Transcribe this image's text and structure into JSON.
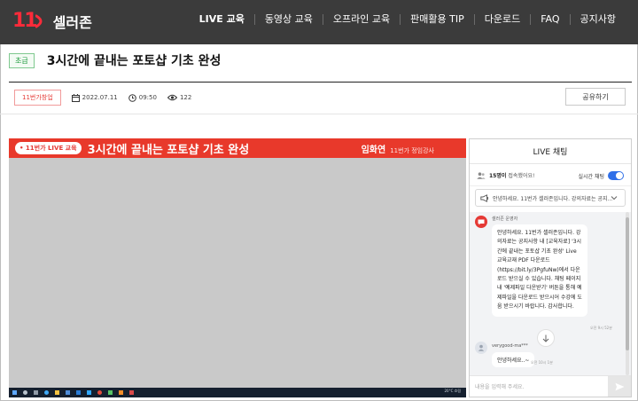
{
  "header": {
    "logo_mark": "11",
    "logo_text": "셀러존",
    "nav": [
      {
        "label": "LIVE 교육",
        "active": true
      },
      {
        "label": "동영상 교육"
      },
      {
        "label": "오프라인 교육"
      },
      {
        "label": "판매활용 TIP"
      },
      {
        "label": "다운로드"
      },
      {
        "label": "FAQ"
      },
      {
        "label": "공지사항"
      }
    ]
  },
  "course": {
    "level": "초급",
    "title": "3시간에 끝내는 포토샵 기초 완성",
    "category": "11번가창업",
    "date": "2022.07.11",
    "time": "09:50",
    "views": "122",
    "share_label": "공유하기"
  },
  "video": {
    "live_pill": "• 11번가 LIVE 교육",
    "banner_title": "3시간에 끝내는 포토샵 기초 완성",
    "presenter_name": "임화연",
    "presenter_role": "11번가 정임강사",
    "taskbar_status": "20°C 흐림"
  },
  "chat": {
    "title": "LIVE 채팅",
    "viewers_count": "15명이",
    "viewers_suffix": "접속했어요!",
    "realtime_label": "실시간 채팅",
    "notice": "안녕하세요. 11번가 셀러존입니다. 강의자료는 공지...",
    "messages": [
      {
        "name": "셀러존 운영자",
        "text": "안녕하세요. 11번가 셀러존입니다. 강의자료는 공지사항 내 [교육자료] '3시간에 끝내는 포토샵 기초 완성' Live 교육교재 PDF 다운로드 (https://bit.ly/3PgfuNw)에서 다운로드 받으실 수 있습니다. 채팅 페이지 내 '예제파일 다운받기' 버튼을 통해 예제파일을 다운로드 받으시어 수강에 도움 받으시기 바랍니다. 감사합니다.",
        "time": "오전 9시 52분"
      },
      {
        "name": "verygood-ma***",
        "text": "안녕하세요..~",
        "time": "오전 10시 1분"
      }
    ],
    "input_placeholder": "내용을 입력해 주세요."
  },
  "colors": {
    "brand_red": "#e8392b",
    "header_bg": "#3b3b3b",
    "toggle_blue": "#2f6fe8"
  }
}
